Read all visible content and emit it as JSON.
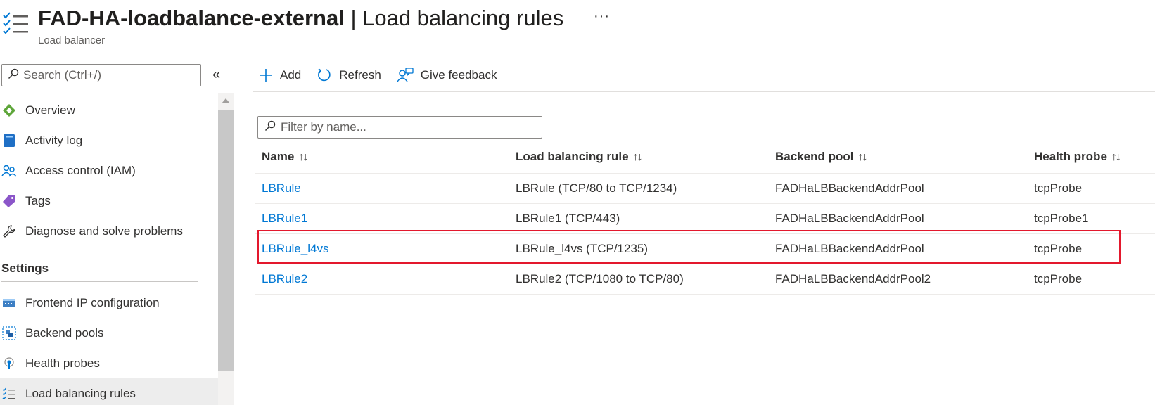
{
  "header": {
    "resource_name": "FAD-HA-loadbalance-external",
    "separator": " | ",
    "page_title": "Load balancing rules",
    "more_label": "···",
    "resource_type": "Load balancer"
  },
  "sidebar": {
    "search_placeholder": "Search (Ctrl+/)",
    "collapse_label": "«",
    "items": [
      {
        "label": "Overview",
        "icon": "overview-icon"
      },
      {
        "label": "Activity log",
        "icon": "activity-log-icon"
      },
      {
        "label": "Access control (IAM)",
        "icon": "iam-icon"
      },
      {
        "label": "Tags",
        "icon": "tag-icon"
      },
      {
        "label": "Diagnose and solve problems",
        "icon": "wrench-icon"
      }
    ],
    "section_label": "Settings",
    "settings_items": [
      {
        "label": "Frontend IP configuration",
        "icon": "frontend-ip-icon"
      },
      {
        "label": "Backend pools",
        "icon": "backend-pool-icon"
      },
      {
        "label": "Health probes",
        "icon": "health-probe-icon"
      },
      {
        "label": "Load balancing rules",
        "icon": "rules-list-icon",
        "active": true
      }
    ]
  },
  "toolbar": {
    "add_label": "Add",
    "refresh_label": "Refresh",
    "feedback_label": "Give feedback"
  },
  "filter": {
    "placeholder": "Filter by name..."
  },
  "table": {
    "columns": [
      "Name",
      "Load balancing rule",
      "Backend pool",
      "Health probe"
    ],
    "sort_glyph": "↑↓",
    "rows": [
      {
        "name": "LBRule",
        "rule": "LBRule (TCP/80 to TCP/1234)",
        "pool": "FADHaLBBackendAddrPool",
        "probe": "tcpProbe"
      },
      {
        "name": "LBRule1",
        "rule": "LBRule1 (TCP/443)",
        "pool": "FADHaLBBackendAddrPool",
        "probe": "tcpProbe1"
      },
      {
        "name": "LBRule_l4vs",
        "rule": "LBRule_l4vs (TCP/1235)",
        "pool": "FADHaLBBackendAddrPool",
        "probe": "tcpProbe"
      },
      {
        "name": "LBRule2",
        "rule": "LBRule2 (TCP/1080 to TCP/80)",
        "pool": "FADHaLBBackendAddrPool2",
        "probe": "tcpProbe"
      }
    ],
    "highlighted_row": 2
  },
  "colors": {
    "link": "#0078d4",
    "highlight": "#e3182d",
    "active_nav_bg": "#ededed"
  }
}
